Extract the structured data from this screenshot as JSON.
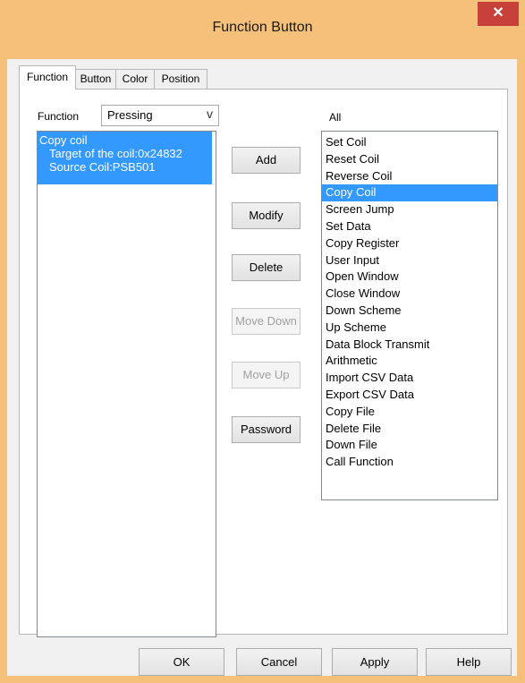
{
  "window": {
    "title": "Function Button",
    "close_glyph": "✕"
  },
  "tabs": [
    "Function",
    "Button",
    "Color",
    "Position"
  ],
  "function_label": "Function",
  "function_combo": {
    "value": "Pressing",
    "arrow_glyph": "v"
  },
  "defined_functions": {
    "lines": [
      "Copy coil",
      "Target of the coil:0x24832",
      "Source Coil:PSB501"
    ]
  },
  "all_label": "All",
  "all_functions": [
    "Set Coil",
    "Reset Coil",
    "Reverse Coil",
    "Copy Coil",
    "Screen Jump",
    "Set Data",
    "Copy Register",
    "User Input",
    "Open Window",
    "Close Window",
    "Down Scheme",
    "Up Scheme",
    "Data Block Transmit",
    "Arithmetic",
    "Import CSV Data",
    "Export CSV Data",
    "Copy File",
    "Delete File",
    "Down File",
    "Call Function"
  ],
  "selected_all_function": "Copy Coil",
  "buttons": {
    "add": "Add",
    "modify": "Modify",
    "delete": "Delete",
    "move_down": "Move Down",
    "move_up": "Move Up",
    "password": "Password"
  },
  "dialog_buttons": {
    "ok": "OK",
    "cancel": "Cancel",
    "apply": "Apply",
    "help": "Help"
  },
  "colors": {
    "frame": "#f4c07a",
    "close_button": "#c7403a",
    "selection": "#3399ff"
  }
}
